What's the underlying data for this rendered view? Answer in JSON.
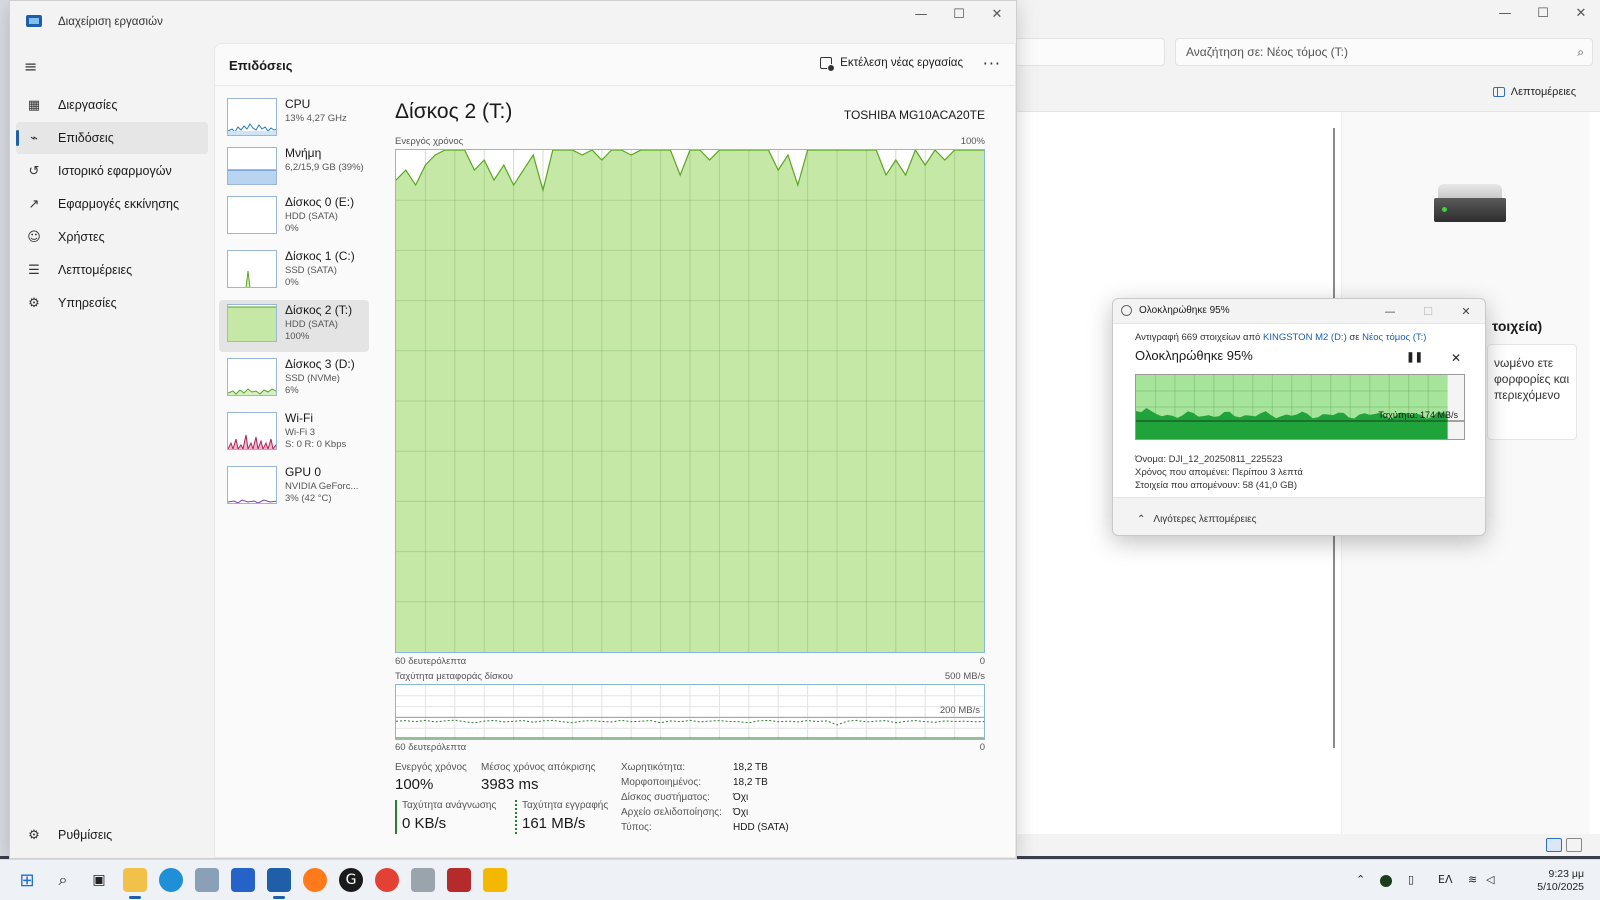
{
  "colors": {
    "accent": "#1f5fa8",
    "disk_fill": "#c5e8a7",
    "disk_line": "#5aa61e",
    "copy_green": "#1fa33a",
    "link": "#1a5fb4"
  },
  "taskmgr": {
    "title": "Διαχείριση εργασιών",
    "nav": [
      {
        "label": "Διεργασίες",
        "icon": "processes-icon"
      },
      {
        "label": "Επιδόσεις",
        "icon": "performance-icon"
      },
      {
        "label": "Ιστορικό εφαρμογών",
        "icon": "history-icon"
      },
      {
        "label": "Εφαρμογές εκκίνησης",
        "icon": "startup-icon"
      },
      {
        "label": "Χρήστες",
        "icon": "users-icon"
      },
      {
        "label": "Λεπτομέρειες",
        "icon": "details-icon"
      },
      {
        "label": "Υπηρεσίες",
        "icon": "services-icon"
      }
    ],
    "settings_label": "Ρυθμίσεις",
    "header_title": "Επιδόσεις",
    "run_task_label": "Εκτέλεση νέας εργασίας",
    "resources": [
      {
        "name": "CPU",
        "sub1": "13% 4,27 GHz",
        "sub2": "",
        "sub3": ""
      },
      {
        "name": "Μνήμη",
        "sub1": "6,2/15,9 GB (39%)",
        "sub2": "",
        "sub3": ""
      },
      {
        "name": "Δίσκος 0 (E:)",
        "sub1": "HDD (SATA)",
        "sub2": "0%",
        "sub3": ""
      },
      {
        "name": "Δίσκος 1 (C:)",
        "sub1": "SSD (SATA)",
        "sub2": "0%",
        "sub3": ""
      },
      {
        "name": "Δίσκος 2 (T:)",
        "sub1": "HDD (SATA)",
        "sub2": "100%",
        "sub3": ""
      },
      {
        "name": "Δίσκος 3 (D:)",
        "sub1": "SSD (NVMe)",
        "sub2": "6%",
        "sub3": ""
      },
      {
        "name": "Wi-Fi",
        "sub1": "Wi-Fi 3",
        "sub2": "S: 0 R: 0 Kbps",
        "sub3": ""
      },
      {
        "name": "GPU 0",
        "sub1": "NVIDIA GeForc...",
        "sub2": "3% (42 °C)",
        "sub3": ""
      }
    ],
    "detail": {
      "title": "Δίσκος 2 (T:)",
      "model": "TOSHIBA MG10ACA20TE",
      "active_time_label": "Ενεργός χρόνος",
      "active_time_max": "100%",
      "x_left_1": "60 δευτερόλεπτα",
      "x_right_1": "0",
      "transfer_label": "Ταχύτητα μεταφοράς δίσκου",
      "transfer_max": "500 MB/s",
      "transfer_ref": "200 MB/s",
      "x_left_2": "60 δευτερόλεπτα",
      "x_right_2": "0"
    },
    "stats": {
      "active_label": "Ενεργός χρόνος",
      "active_value": "100%",
      "resp_label": "Μέσος χρόνος απόκρισης",
      "resp_value": "3983 ms",
      "read_label": "Ταχύτητα ανάγνωσης",
      "read_value": "0 KB/s",
      "write_label": "Ταχύτητα εγγραφής",
      "write_value": "161 MB/s"
    },
    "properties": [
      {
        "key": "Χωρητικότητα:",
        "value": "18,2 TB"
      },
      {
        "key": "Μορφοποιημένος:",
        "value": "18,2 TB"
      },
      {
        "key": "Δίσκος συστήματος:",
        "value": "Όχι"
      },
      {
        "key": "Αρχείο σελιδοποίησης:",
        "value": "Όχι"
      },
      {
        "key": "Τύπος:",
        "value": "HDD (SATA)"
      }
    ]
  },
  "chart_data": [
    {
      "type": "area",
      "title": "Ενεργός χρόνος",
      "xlabel": "60 δευτερόλεπτα",
      "ylim": [
        0,
        100
      ],
      "x_ticks": [
        "60 δευτερόλεπτα",
        "0"
      ],
      "y_ticks": [
        "100%"
      ],
      "grid": true,
      "series": [
        {
          "values": [
            94,
            96,
            93,
            97,
            99,
            100,
            100,
            100,
            96,
            98,
            94,
            97,
            93,
            96,
            99,
            92,
            100,
            100,
            100,
            99,
            100,
            98,
            100,
            100,
            99,
            100,
            100,
            100,
            100,
            95,
            100,
            100,
            98,
            100,
            100,
            100,
            100,
            100,
            100,
            96,
            99,
            93,
            100,
            100,
            100,
            100,
            100,
            100,
            100,
            100,
            95,
            98,
            95,
            100,
            97,
            100,
            98,
            100,
            100,
            100,
            100
          ]
        }
      ]
    },
    {
      "type": "line",
      "title": "Ταχύτητα μεταφοράς δίσκου",
      "xlabel": "60 δευτερόλεπτα",
      "ylim": [
        0,
        500
      ],
      "reference_line": 200,
      "x_ticks": [
        "60 δευτερόλεπτα",
        "0"
      ],
      "y_ticks": [
        "500 MB/s",
        "200 MB/s"
      ],
      "grid": true,
      "series": [
        {
          "values": [
            165,
            170,
            160,
            172,
            158,
            168,
            175,
            160,
            150,
            166,
            172,
            158,
            164,
            170,
            155,
            168,
            172,
            160,
            150,
            166,
            170,
            162,
            158,
            172,
            160,
            165,
            170,
            150,
            168,
            160,
            172,
            158,
            166,
            170,
            162,
            160,
            150,
            168,
            172,
            160,
            165,
            158,
            170,
            162,
            168,
            130,
            165,
            172,
            158,
            166,
            170,
            150,
            164,
            170,
            160,
            155,
            168,
            162,
            165,
            160,
            161
          ]
        },
        {
          "values": [
            0,
            0,
            0,
            0,
            0,
            0,
            0,
            0,
            0,
            0,
            0,
            0,
            0,
            0,
            0,
            0,
            0,
            0,
            0,
            0,
            0,
            0,
            0,
            0,
            0,
            0,
            0,
            0,
            0,
            0,
            0,
            0,
            0,
            0,
            0,
            0,
            0,
            0,
            0,
            0,
            0,
            0,
            0,
            0,
            0,
            0,
            0,
            0,
            0,
            0,
            0,
            0,
            0,
            0,
            0,
            0,
            0,
            0,
            0,
            0,
            0
          ]
        }
      ]
    }
  ],
  "explorer": {
    "search_placeholder": "Αναζήτηση σε: Νέος τόμος (T:)",
    "details_label": "Λεπτομέρειες",
    "detail_heading": "τοιχεία)",
    "detail_text": "νωμένο ετε φορφορίες και περιεχόμενο"
  },
  "copy_dialog": {
    "title": "Ολοκληρώθηκε 95%",
    "line_prefix": "Αντιγραφή 669 στοιχείων από",
    "source": "KINGSTON M2 (D:)",
    "line_mid": "σε",
    "dest": "Νέος τόμος (T:)",
    "progress_title": "Ολοκληρώθηκε 95%",
    "progress": 0.95,
    "speed": "Ταχύτητα: 174 MB/s",
    "name_line": "Όνομα:  DJI_12_20250811_225523",
    "time_line": "Χρόνος που απομένει:  Περίπου 3 λεπτά",
    "items_line": "Στοιχεία που απομένουν:  58 (41,0 GB)",
    "fewer_details": "Λιγότερες λεπτομέρειες"
  },
  "taskbar": {
    "lang": "ΕΛ",
    "time": "9:23 μμ",
    "date": "5/10/2025"
  }
}
